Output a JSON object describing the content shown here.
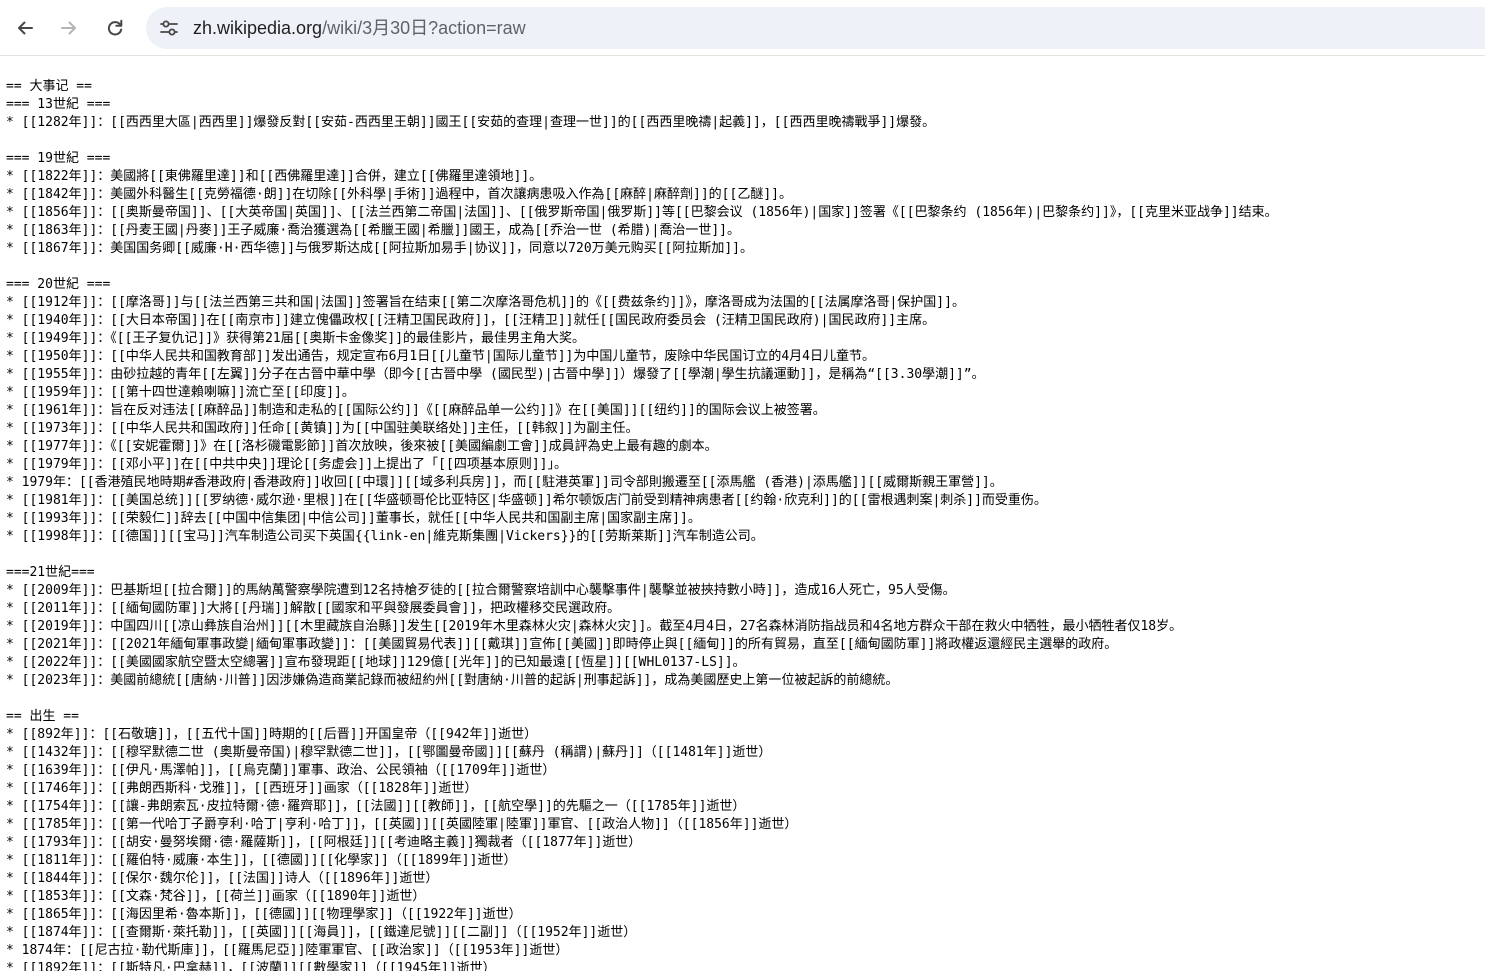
{
  "browser": {
    "url_host": "zh.wikipedia.org",
    "url_path": "/wiki/3月30日?action=raw",
    "icons": {
      "back": "arrow-left-icon",
      "forward": "arrow-right-icon",
      "reload": "reload-icon",
      "site_info": "tune-icon"
    }
  },
  "raw_lines": [
    "== 大事记 ==",
    "=== 13世紀 ===",
    "* [[1282年]]：[[西西里大區|西西里]]爆發反對[[安茹-西西里王朝]]國王[[安茹的查理|查理一世]]的[[西西里晚禱|起義]]，[[西西里晚禱戰爭]]爆發。",
    "",
    "=== 19世紀 ===",
    "* [[1822年]]：美國將[[東佛羅里達]]和[[西佛羅里達]]合併，建立[[佛羅里達領地]]。",
    "* [[1842年]]：美國外科醫生[[克勞福德·朗]]在切除[[外科學|手術]]過程中，首次讓病患吸入作為[[麻醉|麻醉劑]]的[[乙醚]]。",
    "* [[1856年]]：[[奥斯曼帝国]]、[[大英帝国|英国]]、[[法兰西第二帝国|法国]]、[[俄罗斯帝国|俄罗斯]]等[[巴黎会议 (1856年)|国家]]签署《[[巴黎条约 (1856年)|巴黎条约]]》，[[克里米亚战争]]结束。",
    "* [[1863年]]：[[丹麦王國|丹麥]]王子威廉·喬治獲選為[[希臘王國|希臘]]國王，成為[[乔治一世 (希腊)|喬治一世]]。",
    "* [[1867年]]：美国国务卿[[威廉·H·西华德]]与俄罗斯达成[[阿拉斯加易手|协议]]，同意以720万美元购买[[阿拉斯加]]。",
    "",
    "=== 20世紀 ===",
    "* [[1912年]]：[[摩洛哥]]与[[法兰西第三共和国|法国]]签署旨在结束[[第二次摩洛哥危机]]的《[[费兹条约]]》，摩洛哥成为法国的[[法属摩洛哥|保护国]]。",
    "* [[1940年]]：[[大日本帝国]]在[[南京市]]建立傀儡政权[[汪精卫国民政府]]，[[汪精卫]]就任[[国民政府委员会 (汪精卫国民政府)|国民政府]]主席。",
    "* [[1949年]]：《[[王子复仇记]]》获得第21届[[奥斯卡金像奖]]的最佳影片，最佳男主角大奖。",
    "* [[1950年]]：[[中华人民共和国教育部]]发出通告，规定宣布6月1日[[儿童节|国际儿童节]]为中国儿童节，废除中华民国订立的4月4日儿童节。",
    "* [[1955年]]：由砂拉越的青年[[左翼]]分子在古晉中華中學（即今[[古晉中學 (國民型)|古晉中學]]）爆發了[[學潮|學生抗議運動]]，是稱為“[[3.30學潮]]”。",
    "* [[1959年]]：[[第十四世達賴喇嘛]]流亡至[[印度]]。",
    "* [[1961年]]：旨在反对违法[[麻醉品]]制造和走私的[[国际公约]]《[[麻醉品单一公约]]》在[[美国]][[纽约]]的国际会议上被签署。",
    "* [[1973年]]：[[中华人民共和国政府]]任命[[黄镇]]为[[中国驻美联络处]]主任，[[韩叙]]为副主任。",
    "* [[1977年]]：《[[安妮霍爾]]》在[[洛杉磯電影節]]首次放映，後來被[[美國編劇工會]]成員評為史上最有趣的劇本。",
    "* [[1979年]]：[[邓小平]]在[[中共中央]]理论[[务虚会]]上提出了「[[四项基本原则]]」。",
    "* 1979年：[[香港殖民地時期#香港政府|香港政府]]收回[[中環]][[域多利兵房]]，而[[駐港英軍]]司令部則搬遷至[[添馬艦 (香港)|添馬艦]][[威爾斯親王軍營]]。",
    "* [[1981年]]：[[美国总统]][[罗纳德·威尔逊·里根]]在[[华盛顿哥伦比亚特区|华盛顿]]希尔顿饭店门前受到精神病患者[[约翰·欣克利]]的[[雷根遇刺案|刺杀]]而受重伤。",
    "* [[1993年]]：[[荣毅仁]]辞去[[中国中信集团|中信公司]]董事长，就任[[中华人民共和国副主席|国家副主席]]。",
    "* [[1998年]]：[[德国]][[宝马]]汽车制造公司买下英国{{link-en|維克斯集團|Vickers}}的[[劳斯莱斯]]汽车制造公司。",
    "",
    "===21世紀===",
    "* [[2009年]]：巴基斯坦[[拉合爾]]的馬納萬警察學院遭到12名持槍歹徒的[[拉合爾警察培訓中心襲擊事件|襲擊並被挾持數小時]]，造成16人死亡，95人受傷。",
    "* [[2011年]]：[[緬甸國防軍]]大將[[丹瑞]]解散[[國家和平與發展委員會]]，把政權移交民選政府。",
    "* [[2019年]]：中国四川[[凉山彝族自治州]][[木里藏族自治縣]]发生[[2019年木里森林火灾|森林火灾]]。截至4月4日，27名森林消防指战员和4名地方群众干部在救火中牺牲，最小牺牲者仅18岁。",
    "* [[2021年]]：[[2021年緬甸軍事政變|緬甸軍事政變]]：[[美國貿易代表]][[戴琪]]宣佈[[美國]]即時停止與[[緬甸]]的所有貿易，直至[[緬甸國防軍]]將政權返還經民主選舉的政府。",
    "* [[2022年]]：[[美國國家航空暨太空總署]]宣布發現距[[地球]]129億[[光年]]的已知最遠[[恆星]][[WHL0137-LS]]。",
    "* [[2023年]]：美國前總統[[唐納·川普]]因涉嫌偽造商業記錄而被紐約州[[對唐納·川普的起訴|刑事起訴]]，成為美國歷史上第一位被起訴的前總統。",
    "",
    "== 出生 ==",
    "* [[892年]]：[[石敬瑭]]，[[五代十国]]時期的[[后晋]]开国皇帝（[[942年]]逝世）",
    "* [[1432年]]：[[穆罕默德二世 (奥斯曼帝国)|穆罕默德二世]]，[[鄂圖曼帝國]][[蘇丹 (稱謂)|蘇丹]]（[[1481年]]逝世）",
    "* [[1639年]]：[[伊凡·馬澤帕]]，[[烏克蘭]]軍事、政治、公民領袖（[[1709年]]逝世）",
    "* [[1746年]]：[[弗朗西斯科·戈雅]]，[[西班牙]]画家（[[1828年]]逝世）",
    "* [[1754年]]：[[讓-弗朗索瓦·皮拉特爾·德·羅齊耶]]，[[法國]][[教師]]，[[航空學]]的先驅之一（[[1785年]]逝世）",
    "* [[1785年]]：[[第一代哈丁子爵亨利·哈丁|亨利·哈丁]]，[[英國]][[英國陸軍|陸軍]]軍官、[[政治人物]]（[[1856年]]逝世）",
    "* [[1793年]]：[[胡安·曼努埃爾·德·羅薩斯]]，[[阿根廷]][[考迪略主義]]獨裁者（[[1877年]]逝世）",
    "* [[1811年]]：[[羅伯特·威廉·本生]]，[[德國]][[化學家]]（[[1899年]]逝世）",
    "* [[1844年]]：[[保尔·魏尔伦]]，[[法国]]诗人（[[1896年]]逝世）",
    "* [[1853年]]：[[文森·梵谷]]，[[荷兰]]画家（[[1890年]]逝世）",
    "* [[1865年]]：[[海因里希·魯本斯]]，[[德國]][[物理學家]]（[[1922年]]逝世）",
    "* [[1874年]]：[[查爾斯·萊托勒]]，[[英國]][[海員]]，[[鐵達尼號]][[二副]]（[[1952年]]逝世）",
    "* 1874年：[[尼古拉·勒代斯庫]]，[[羅馬尼亞]]陸軍軍官、[[政治家]]（[[1953年]]逝世）",
    "* [[1892年]]：[[斯特凡·巴拿赫]]，[[波蘭]][[數學家]]（[[1945年]]逝世）"
  ]
}
